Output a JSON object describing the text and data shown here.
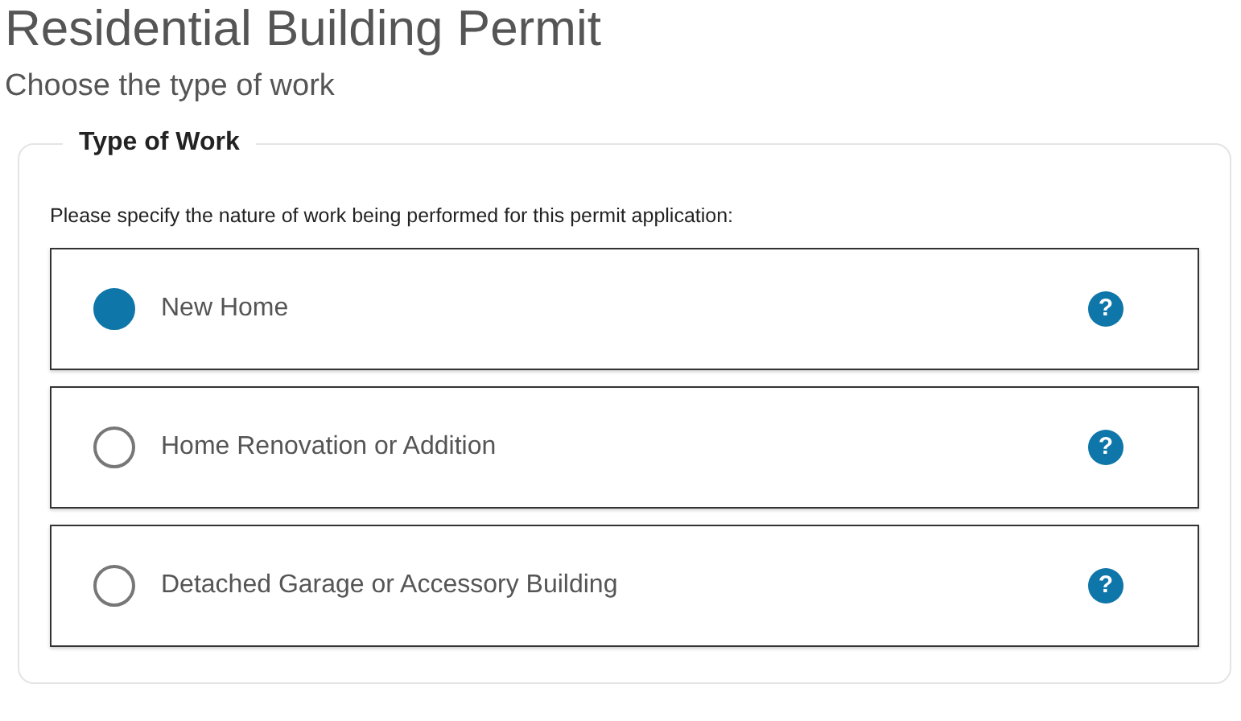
{
  "title": "Residential Building Permit",
  "subtitle": "Choose the type of work",
  "fieldset": {
    "legend": "Type of Work",
    "instruction": "Please specify the nature of work being performed for this permit application:",
    "options": [
      {
        "label": "New Home",
        "selected": true,
        "help": "?"
      },
      {
        "label": "Home Renovation or Addition",
        "selected": false,
        "help": "?"
      },
      {
        "label": "Detached Garage or Accessory Building",
        "selected": false,
        "help": "?"
      }
    ]
  }
}
